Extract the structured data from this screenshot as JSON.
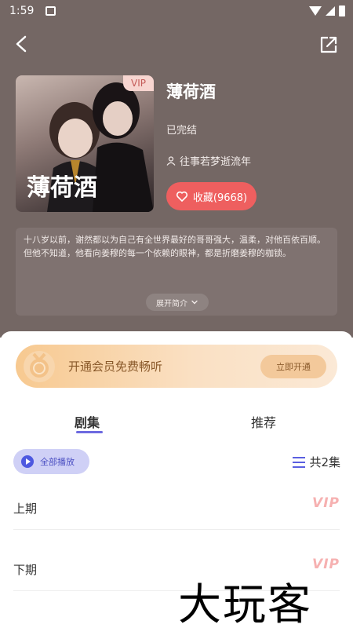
{
  "status_bar": {
    "time": "1:59"
  },
  "book": {
    "title": "薄荷酒",
    "status": "已完结",
    "author": "往事若梦逝流年",
    "cover_badge": "VIP",
    "cover_text": "薄荷酒"
  },
  "favorite": {
    "label": "收藏(9668)"
  },
  "synopsis": {
    "text": "十八岁以前，谢然都以为自己有全世界最好的哥哥强大，温柔，对他百依百顺。但他不知道，他看向姜穆的每一个依赖的眼神，都是折磨姜穆的枷锁。",
    "expand_label": "展开简介"
  },
  "vip_banner": {
    "text": "开通会员免费畅听",
    "button_label": "立即开通"
  },
  "tabs": [
    {
      "label": "剧集",
      "active": true
    },
    {
      "label": "推荐",
      "active": false
    }
  ],
  "episodes_toolbar": {
    "play_all_label": "全部播放",
    "count_label": "共2集"
  },
  "episodes": [
    {
      "title": "上期",
      "badge": "VIP"
    },
    {
      "title": "下期",
      "badge": "VIP"
    }
  ],
  "watermark": "大玩客",
  "colors": {
    "header_bg": "#746764",
    "favorite_bg": "#ee5f5f",
    "accent": "#6d6ae0",
    "vip_gold": "#f7c990"
  }
}
